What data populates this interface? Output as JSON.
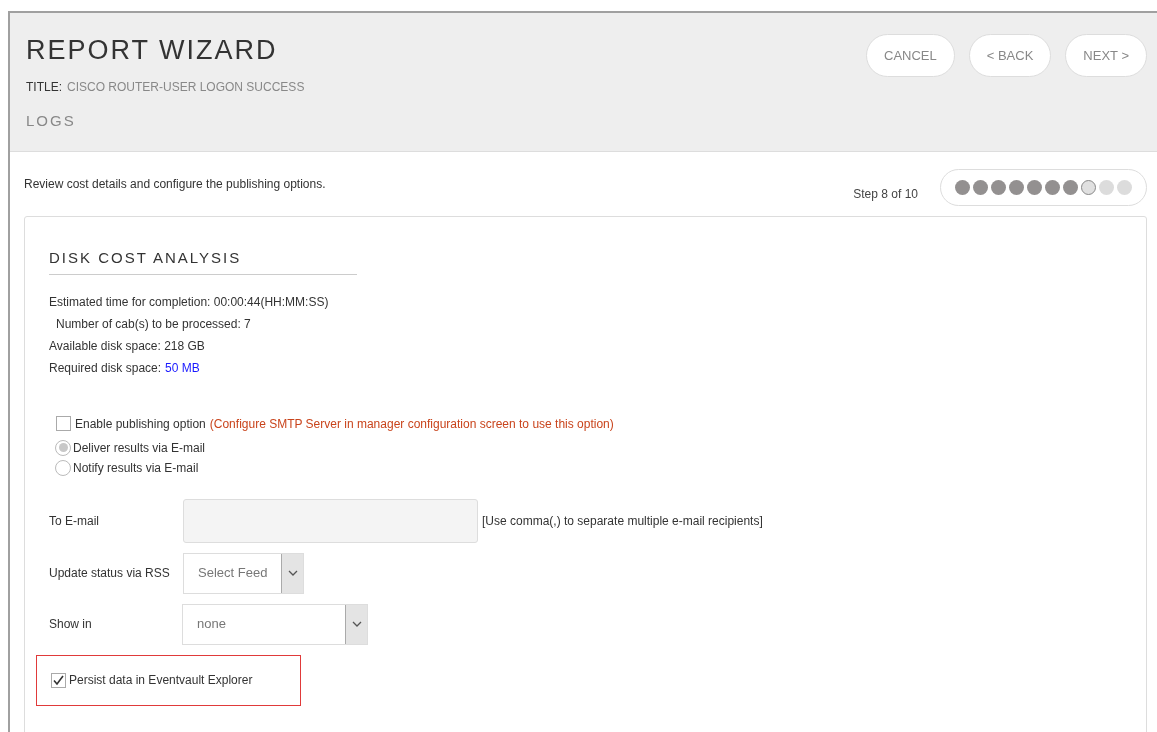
{
  "header": {
    "title": "REPORT WIZARD",
    "title_label": "TITLE:",
    "title_value": "CISCO ROUTER-USER LOGON SUCCESS",
    "subtitle": "LOGS",
    "buttons": [
      {
        "label": "CANCEL"
      },
      {
        "label": "< BACK"
      },
      {
        "label": "NEXT >"
      }
    ]
  },
  "instructions": "Review cost details and configure the publishing options.",
  "step": {
    "label": "Step 8 of 10",
    "dots": [
      {
        "kind": "done"
      },
      {
        "kind": "done"
      },
      {
        "kind": "done"
      },
      {
        "kind": "done"
      },
      {
        "kind": "done"
      },
      {
        "kind": "done"
      },
      {
        "kind": "done"
      },
      {
        "kind": "current"
      },
      {
        "kind": "pending"
      },
      {
        "kind": "pending"
      }
    ]
  },
  "section": {
    "title": "DISK COST ANALYSIS",
    "details": [
      {
        "label": "Estimated time for completion: 00:00:44(HH:MM:SS)",
        "indent": false
      },
      {
        "label": "Number of cab(s) to be processed: 7",
        "indent": true
      },
      {
        "label": "Available disk space: 218 GB",
        "indent": false
      },
      {
        "label": "Required disk space:",
        "value": "50 MB",
        "indent": false
      }
    ],
    "publishing": {
      "label": "Enable publishing option",
      "note": "(Configure SMTP Server in manager configuration screen to use this option)",
      "checked": false
    },
    "radios": [
      {
        "label": "Deliver results via E-mail",
        "selected": true
      },
      {
        "label": "Notify results via E-mail",
        "selected": false
      }
    ],
    "to_email": {
      "label": "To E-mail",
      "hint": "[Use comma(,) to separate multiple e-mail recipients]"
    },
    "rss": {
      "label": "Update status via RSS",
      "value": "Select Feed"
    },
    "show_in": {
      "label": "Show in",
      "value": "none"
    },
    "persist": {
      "label": "Persist data in Eventvault Explorer",
      "checked": true,
      "highlighted": true
    }
  }
}
